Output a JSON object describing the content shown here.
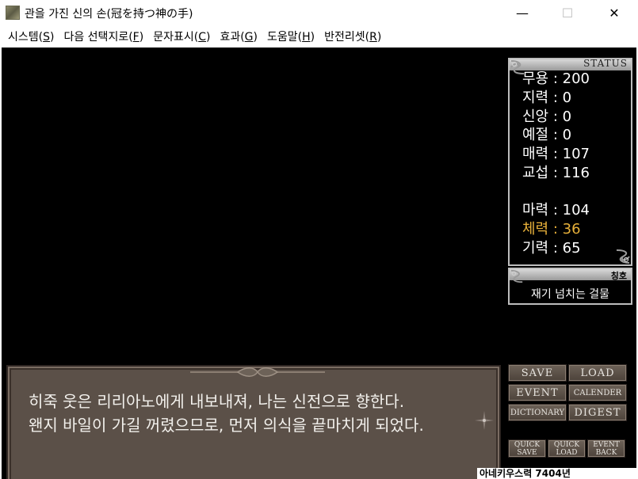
{
  "window": {
    "title": "관을 가진 신의 손(冠を持つ神の手)",
    "controls": {
      "minimize": "—",
      "maximize": "☐",
      "close": "✕"
    }
  },
  "menu": [
    {
      "label": "시스템(",
      "key": "S",
      "end": ")"
    },
    {
      "label": "다음 선택지로(",
      "key": "F",
      "end": ")"
    },
    {
      "label": "문자표시(",
      "key": "C",
      "end": ")"
    },
    {
      "label": "효과(",
      "key": "G",
      "end": ")"
    },
    {
      "label": "도움말(",
      "key": "H",
      "end": ")"
    },
    {
      "label": "반전리셋(",
      "key": "R",
      "end": ")"
    }
  ],
  "status": {
    "title": "STATUS",
    "rows": [
      {
        "text": "무용 : 200",
        "highlight": false
      },
      {
        "text": "지력 : 0",
        "highlight": false
      },
      {
        "text": "신앙 : 0",
        "highlight": false
      },
      {
        "text": "예절 : 0",
        "highlight": false
      },
      {
        "text": "매력 : 107",
        "highlight": false
      },
      {
        "text": "교섭 : 116",
        "highlight": false
      },
      {
        "text": "마력 : 104",
        "highlight": false
      },
      {
        "text": "체력 : 36",
        "highlight": true
      },
      {
        "text": "기력 : 65",
        "highlight": false
      }
    ],
    "highlight_color": "#e8b13a"
  },
  "honorific": {
    "label": "칭호",
    "value": "재기 넘치는 걸물"
  },
  "message": {
    "lines": [
      "히죽 웃은 리리아노에게 내보내져, 나는 신전으로 향한다.",
      "왠지 바일이 가길 꺼렸으므로, 먼저 의식을 끝마치게 되었다."
    ]
  },
  "buttons": {
    "save": "SAVE",
    "load": "LOAD",
    "event": "EVENT",
    "calender": "CALENDER",
    "dictionary": "DICTIONARY",
    "digest": "DIGEST",
    "quick_save": "QUICK\nSAVE",
    "quick_load": "QUICK\nLOAD",
    "event_back": "EVENT\nBACK"
  },
  "date": "아네키우스력 7404년"
}
